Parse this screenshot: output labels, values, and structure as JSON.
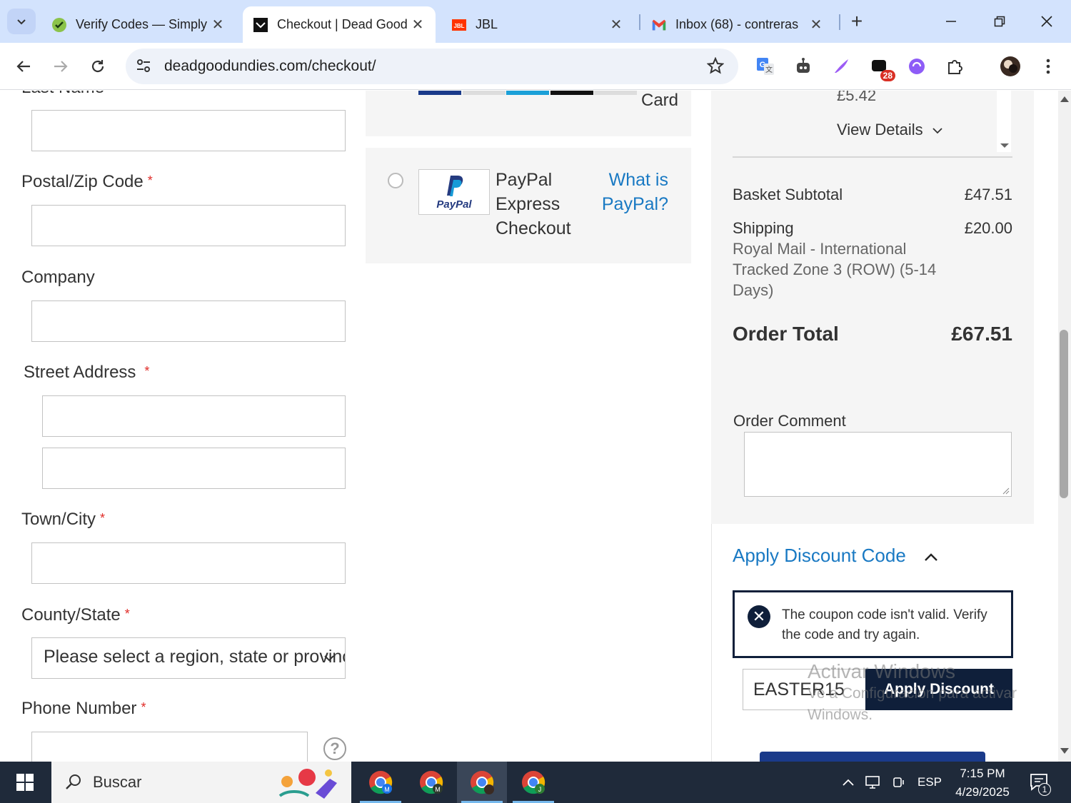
{
  "browser": {
    "tabs": [
      {
        "title": "Verify Codes — Simply",
        "icon": "verify-favicon",
        "active": false
      },
      {
        "title": "Checkout | Dead Good",
        "icon": "deadgood-favicon",
        "active": true
      },
      {
        "title": "JBL",
        "icon": "jbl-favicon",
        "active": false
      },
      {
        "title": "Inbox (68) - contreras",
        "icon": "gmail-favicon",
        "active": false
      }
    ],
    "url": "deadgoodundies.com/checkout/",
    "extension_badge": "28"
  },
  "shipping_form": {
    "last_name_label": "Last Name",
    "postal_label": "Postal/Zip Code",
    "company_label": "Company",
    "street_label": "Street Address",
    "city_label": "Town/City",
    "county_label": "County/State",
    "county_select": "Please select a region, state or province",
    "phone_label": "Phone Number",
    "required_mark": "*",
    "help_glyph": "?"
  },
  "payment": {
    "card_label": "Card",
    "paypal_label": "PayPal Express Checkout",
    "paypal_link": "What is PayPal?",
    "paypal_logo_text": "PayPal"
  },
  "summary": {
    "item_price": "£5.42",
    "view_details": "View Details",
    "basket_subtotal_label": "Basket Subtotal",
    "basket_subtotal_value": "£47.51",
    "shipping_label": "Shipping",
    "shipping_value": "£20.00",
    "shipping_method": "Royal Mail - International Tracked Zone 3 (ROW) (5-14 Days)",
    "order_total_label": "Order Total",
    "order_total_value": "£67.51",
    "order_comment_label": "Order Comment"
  },
  "discount": {
    "toggle_label": "Apply Discount Code",
    "error_message": "The coupon code isn't valid. Verify the code and try again.",
    "code_value": "EASTER15",
    "apply_label": "Apply Discount"
  },
  "watermark": {
    "line1": "Activar Windows",
    "line2": "Ve a Configuración para activar",
    "line3": "Windows."
  },
  "taskbar": {
    "search_text": "Buscar",
    "language": "ESP",
    "time": "7:15 PM",
    "date": "4/29/2025",
    "notifications": "1",
    "apps": [
      "chrome-m",
      "chrome-m2",
      "chrome-active",
      "chrome-j"
    ]
  },
  "colors": {
    "accent_blue": "#1979c3",
    "navy": "#0f1f3a",
    "required_red": "#e02b27"
  }
}
